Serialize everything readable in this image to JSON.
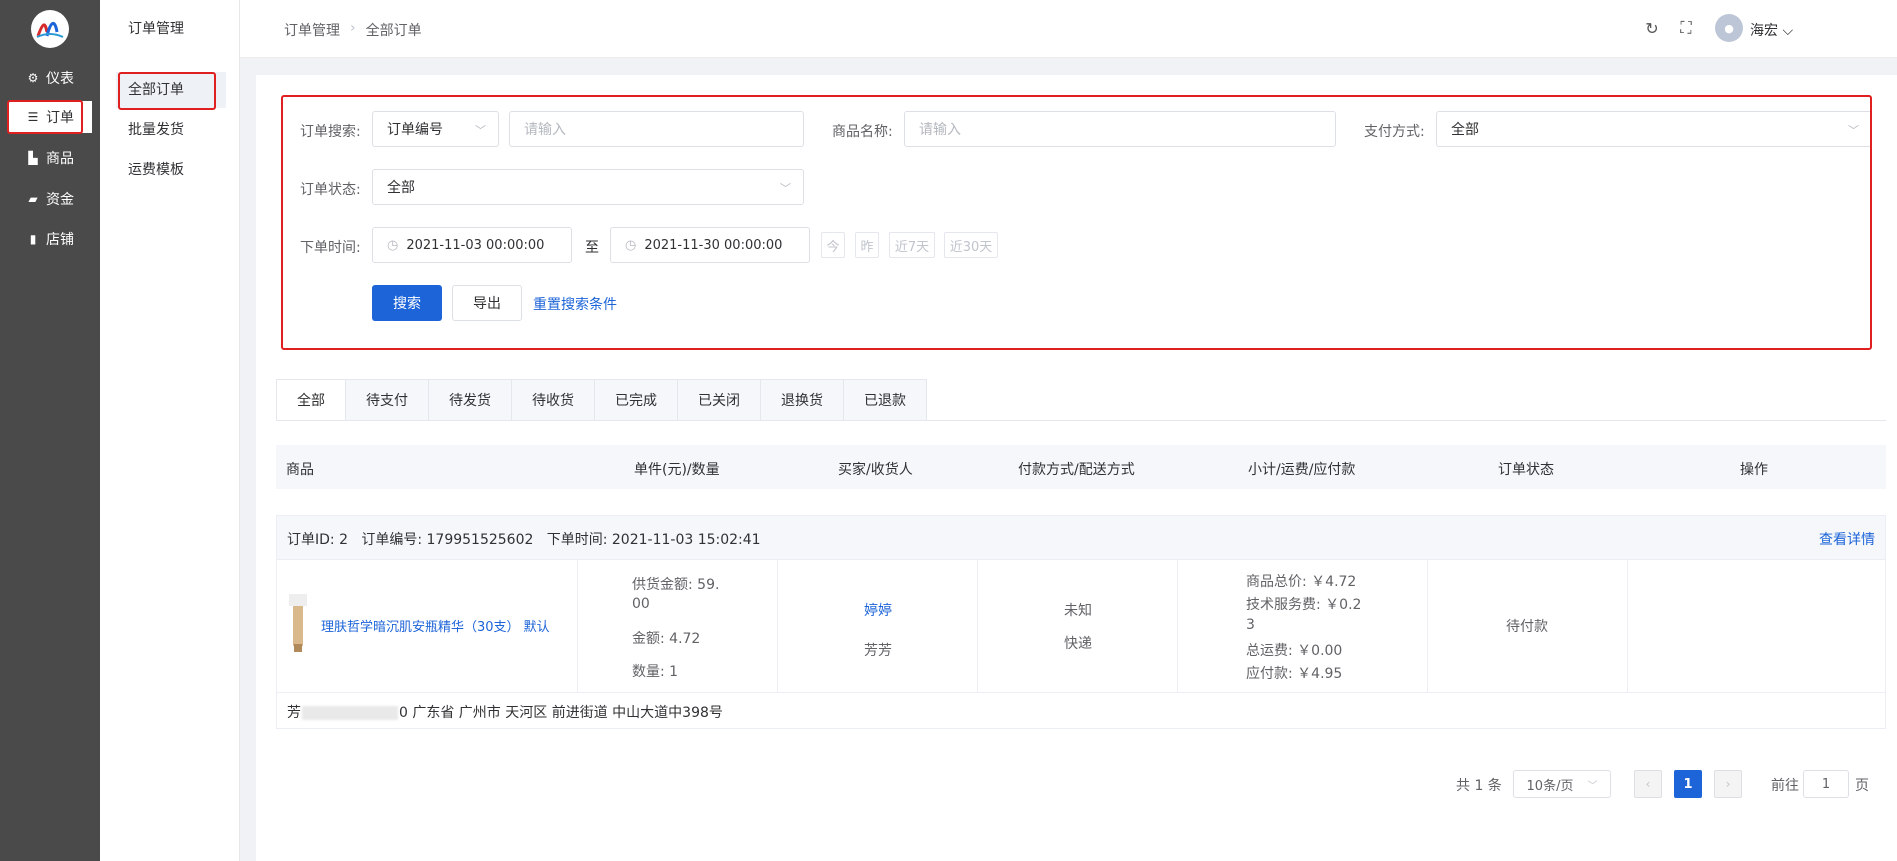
{
  "sidebar": {
    "items": [
      {
        "label": "仪表",
        "icon": "gear-icon"
      },
      {
        "label": "订单",
        "icon": "list-icon"
      },
      {
        "label": "商品",
        "icon": "bag-icon"
      },
      {
        "label": "资金",
        "icon": "wallet-icon"
      },
      {
        "label": "店铺",
        "icon": "store-icon"
      }
    ]
  },
  "subnav": {
    "title": "订单管理",
    "items": [
      {
        "label": "全部订单"
      },
      {
        "label": "批量发货"
      },
      {
        "label": "运费模板"
      }
    ]
  },
  "header": {
    "breadcrumb": [
      "订单管理",
      "全部订单"
    ],
    "user_name": "海宏"
  },
  "filters": {
    "order_search_label": "订单搜索:",
    "order_search_type": "订单编号",
    "order_search_placeholder": "请输入",
    "product_name_label": "商品名称:",
    "product_name_placeholder": "请输入",
    "payment_label": "支付方式:",
    "payment_value": "全部",
    "status_label": "订单状态:",
    "status_value": "全部",
    "time_label": "下单时间:",
    "time_start": "2021-11-03 00:00:00",
    "time_sep": "至",
    "time_end": "2021-11-30 00:00:00",
    "quick": [
      "今",
      "昨",
      "近7天",
      "近30天"
    ],
    "search_btn": "搜索",
    "export_btn": "导出",
    "reset_link": "重置搜索条件"
  },
  "tabs": [
    "全部",
    "待支付",
    "待发货",
    "待收货",
    "已完成",
    "已关闭",
    "退换货",
    "已退款"
  ],
  "table": {
    "columns": [
      "商品",
      "单件(元)/数量",
      "买家/收货人",
      "付款方式/配送方式",
      "小计/运费/应付款",
      "订单状态",
      "操作"
    ]
  },
  "order": {
    "header_text": "订单ID: 2   订单编号: 179951525602   下单时间: 2021-11-03 15:02:41",
    "detail_link": "查看详情",
    "product_name": "理肤哲学暗沉肌安瓶精华（30支） 默认",
    "supply_amount_l1": "供货金额: 59.",
    "supply_amount_l2": "00",
    "amount": "金额: 4.72",
    "quantity": "数量: 1",
    "buyer": "婷婷",
    "receiver": "芳芳",
    "payment": "未知",
    "delivery": "快递",
    "goods_total": "商品总价: ￥4.72",
    "service_fee_l1": "技术服务费: ￥0.2",
    "service_fee_l2": "3",
    "shipping": "总运费: ￥0.00",
    "payable": "应付款: ￥4.95",
    "status": "待付款",
    "addr_prefix": "芳",
    "addr_suffix": "0 广东省 广州市 天河区 前进街道 中山大道中398号"
  },
  "pagination": {
    "total": "共 1 条",
    "page_size": "10条/页",
    "current": "1",
    "goto_label": "前往",
    "goto_value": "1",
    "goto_suffix": "页"
  },
  "colors": {
    "primary": "#1d64d8",
    "sidebar": "#4a4a4a",
    "highlight": "#e02020"
  }
}
